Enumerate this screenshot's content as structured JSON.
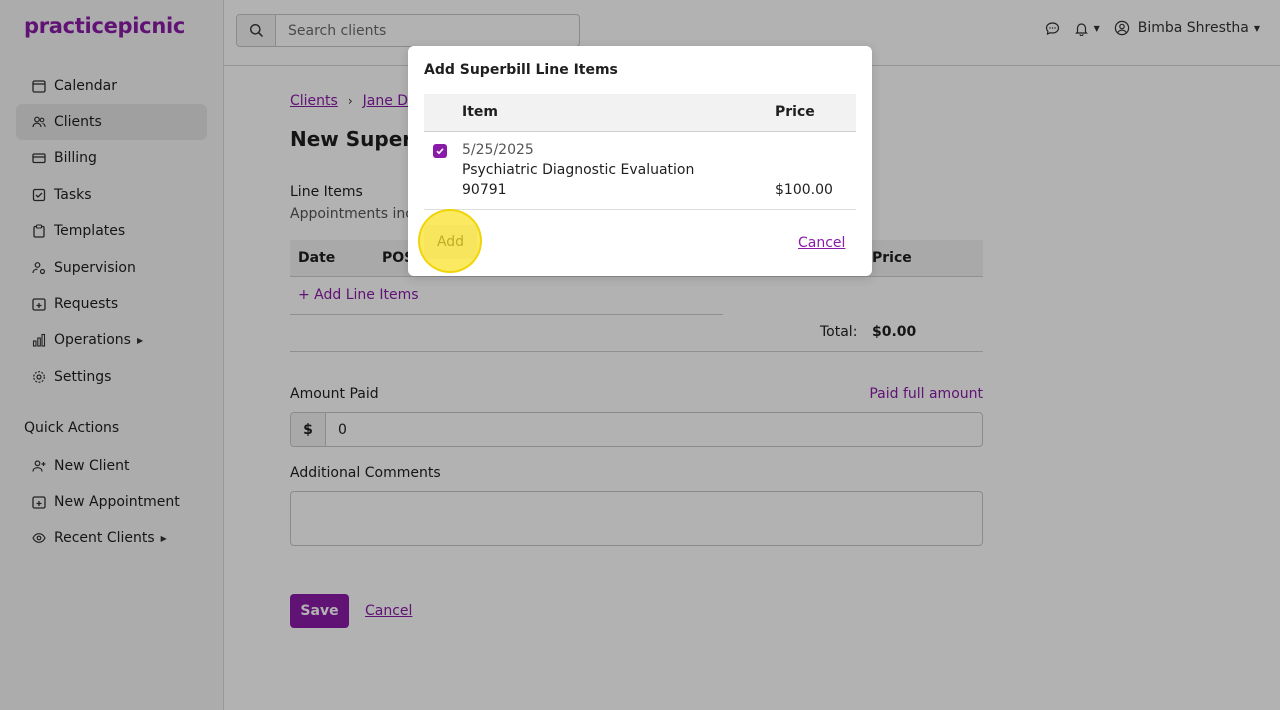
{
  "brand": {
    "logo": "practicepicnic",
    "accent": "#8a1aa8"
  },
  "sidebar": {
    "items": [
      {
        "label": "Calendar",
        "icon": "calendar-icon"
      },
      {
        "label": "Clients",
        "icon": "users-icon",
        "active": true
      },
      {
        "label": "Billing",
        "icon": "credit-card-icon"
      },
      {
        "label": "Tasks",
        "icon": "checkbox-icon"
      },
      {
        "label": "Templates",
        "icon": "clipboard-icon"
      },
      {
        "label": "Supervision",
        "icon": "user-cog-icon"
      },
      {
        "label": "Requests",
        "icon": "calendar-plus-icon"
      },
      {
        "label": "Operations",
        "icon": "bar-chart-icon",
        "has_submenu": true
      },
      {
        "label": "Settings",
        "icon": "gear-icon"
      }
    ],
    "quick_actions_label": "Quick Actions",
    "quick_actions": [
      {
        "label": "New Client",
        "icon": "user-plus-icon"
      },
      {
        "label": "New Appointment",
        "icon": "calendar-plus-icon"
      },
      {
        "label": "Recent Clients",
        "icon": "eye-icon",
        "has_submenu": true
      }
    ]
  },
  "topbar": {
    "search_placeholder": "Search clients",
    "user_name": "Bimba Shrestha"
  },
  "main": {
    "breadcrumb": [
      "Clients",
      "Jane Do"
    ],
    "title": "New Superb",
    "line_items_title": "Line Items",
    "line_items_desc": "Appointments incl",
    "table_headers": {
      "date": "Date",
      "pos": "POS",
      "price": "Price"
    },
    "add_line_items": "+ Add Line Items",
    "total_label": "Total:",
    "total_value": "$0.00",
    "amount_paid_label": "Amount Paid",
    "paid_full_amount": "Paid full amount",
    "currency_prefix": "$",
    "amount_value": "0",
    "comments_label": "Additional Comments",
    "save_label": "Save",
    "cancel_label": "Cancel"
  },
  "modal": {
    "title": "Add Superbill Line Items",
    "headers": {
      "item": "Item",
      "price": "Price"
    },
    "rows": [
      {
        "date": "5/25/2025",
        "name": "Psychiatric Diagnostic Evaluation",
        "code": "90791",
        "price": "$100.00",
        "checked": true
      }
    ],
    "add_label": "Add",
    "cancel_label": "Cancel"
  }
}
